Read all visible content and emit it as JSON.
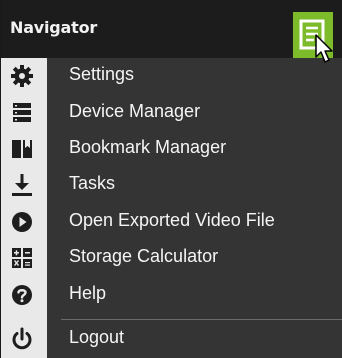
{
  "header": {
    "title": "Navigator"
  },
  "menu": {
    "items": [
      {
        "label": "Settings",
        "icon": "gear-icon"
      },
      {
        "label": "Device Manager",
        "icon": "device-list-icon"
      },
      {
        "label": "Bookmark Manager",
        "icon": "bookmark-icon"
      },
      {
        "label": "Tasks",
        "icon": "download-icon"
      },
      {
        "label": "Open Exported Video File",
        "icon": "play-icon"
      },
      {
        "label": "Storage Calculator",
        "icon": "calculator-icon"
      },
      {
        "label": "Help",
        "icon": "help-icon"
      },
      {
        "label": "Logout",
        "icon": "power-icon"
      }
    ]
  },
  "colors": {
    "header_bg": "#1c1c1c",
    "menu_bg": "#343434",
    "icon_column_bg": "#e9e9e9",
    "accent": "#7dbb2a",
    "text": "#f5f5f5",
    "icon": "#1e1e1e"
  }
}
